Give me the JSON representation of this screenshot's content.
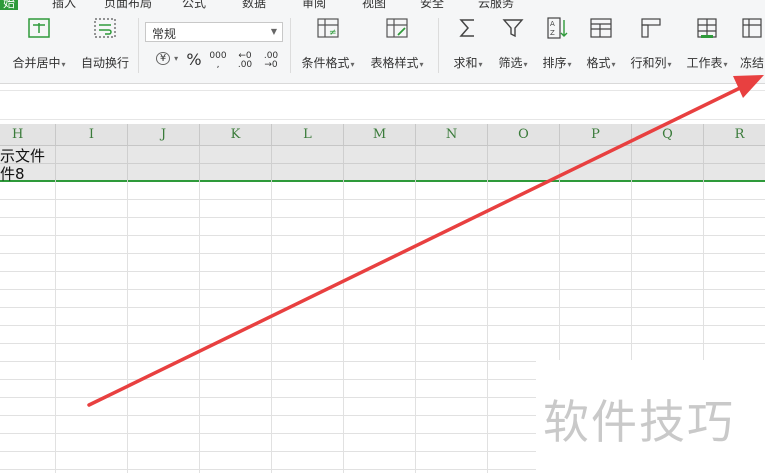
{
  "menu": {
    "tabs": [
      "插入",
      "页面布局",
      "公式",
      "数据",
      "审阅",
      "视图",
      "安全",
      "云服务"
    ]
  },
  "ribbon": {
    "merge_center": "合并居中",
    "wrap_text": "自动换行",
    "number_format": "常规",
    "currency_symbol": "¥",
    "percent_symbol": "%",
    "thousands_label": "000",
    "dec_increase": "←0 .00",
    "dec_decrease": ".00 →0",
    "conditional_format": "条件格式",
    "table_style": "表格样式",
    "sum": "求和",
    "filter": "筛选",
    "sort": "排序",
    "format": "格式",
    "row_col": "行和列",
    "worksheet": "工作表",
    "freeze": "冻结"
  },
  "sheet": {
    "columns": [
      "H",
      "I",
      "J",
      "K",
      "L",
      "M",
      "N",
      "O",
      "P",
      "Q",
      "R"
    ],
    "row1_text": "示文件",
    "row2_text": "件8"
  },
  "watermark": "软件技巧",
  "colors": {
    "accent_green": "#2e9a3a",
    "arrow_red": "#e84040"
  }
}
